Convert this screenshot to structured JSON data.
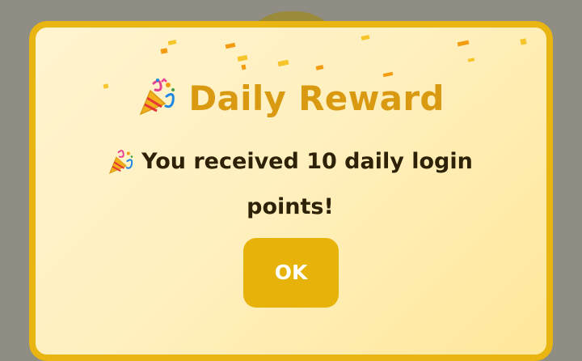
{
  "dialog": {
    "title": "Daily Reward",
    "message": "You received 10 daily login points!",
    "button_label": "OK",
    "icon": "party-popper-icon"
  },
  "colors": {
    "overlay": "#8f8d84",
    "border": "#e8b512",
    "title": "#d99a12",
    "message": "#2d2208",
    "button": "#e7b30b",
    "button_text": "#ffffff",
    "confetti_orange": "#f39c12",
    "confetti_yellow": "#f6c52c"
  }
}
